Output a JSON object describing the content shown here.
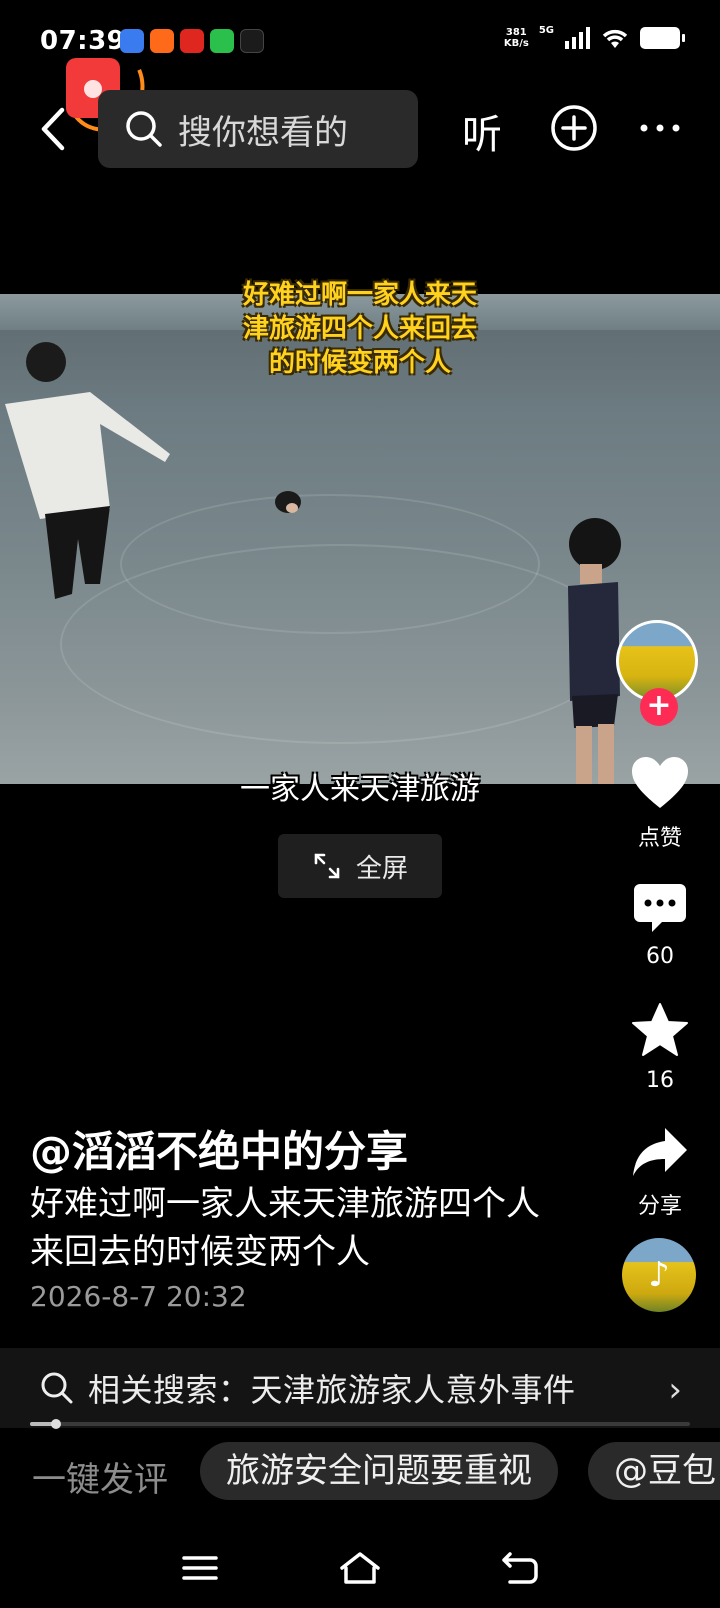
{
  "status_bar": {
    "time": "07:39",
    "net_speed_value": "381",
    "net_speed_unit": "KB/s",
    "network": "5G",
    "notification_icons": [
      "app-blue-icon",
      "app-orange-icon",
      "toutiao-icon",
      "wechat-icon",
      "tiktok-icon"
    ],
    "colors": {
      "app_blue": "#3a7bf0",
      "app_orange": "#ff6a1a",
      "toutiao": "#e0271f",
      "wechat": "#2bc04b",
      "tiktok": "#111111"
    }
  },
  "top_bar": {
    "back_icon": "chevron-left-icon",
    "search_placeholder": "搜你想看的",
    "listen_label": "听",
    "plus_icon": "plus-circle-icon",
    "more_icon": "more-icon"
  },
  "video": {
    "caption_lines": [
      "好难过啊一家人来天",
      "津旅游四个人来回去",
      "的时候变两个人"
    ],
    "subtitle": "一家人来天津旅游",
    "fullscreen_label": "全屏"
  },
  "rail": {
    "like_label": "点赞",
    "comment_count": "60",
    "favorite_count": "16",
    "share_label": "分享",
    "follow_symbol": "+",
    "music_symbol": "♪"
  },
  "post": {
    "author": "@滔滔不绝中的分享",
    "description": "好难过啊一家人来天津旅游四个人来回去的时候变两个人",
    "date": "2026-8-7 20:32"
  },
  "related_search": {
    "text": "相关搜索：天津旅游家人意外事件",
    "chevron": "›"
  },
  "playback": {
    "progress": 0.04
  },
  "quick_comment": {
    "label": "一键发评",
    "chips": [
      "旅游安全问题要重视",
      "@豆包"
    ]
  },
  "nav_bar": {
    "icons": [
      "menu-icon",
      "home-icon",
      "back-icon"
    ]
  },
  "colors": {
    "accent_red": "#fe2c55",
    "caption_yellow": "#ffd21f",
    "search_bg": "#2a2a2a"
  }
}
